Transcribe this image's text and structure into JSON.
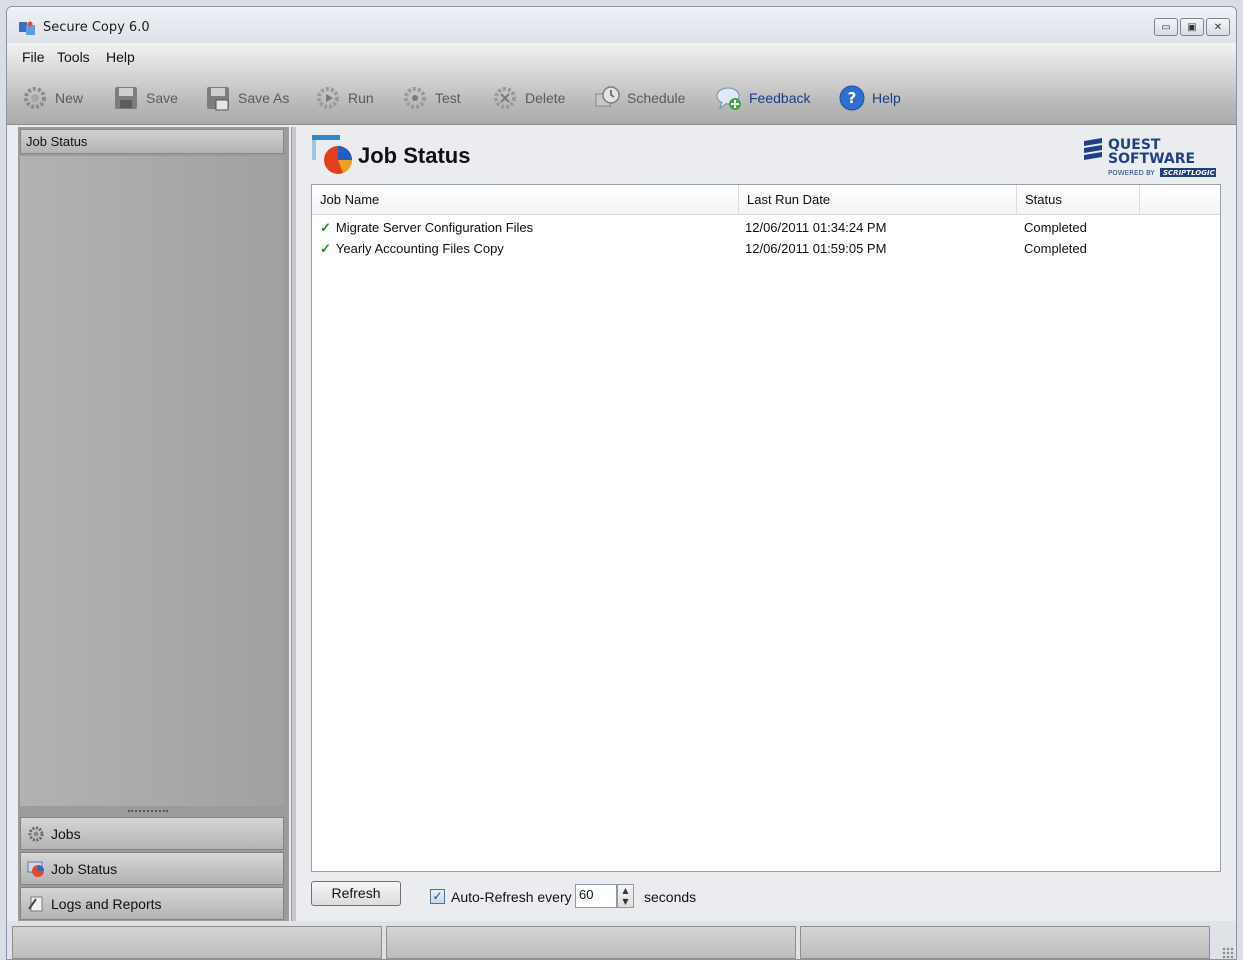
{
  "window": {
    "title": "Secure Copy 6.0"
  },
  "menu": [
    "File",
    "Tools",
    "Help"
  ],
  "toolbar": {
    "new": "New",
    "save": "Save",
    "save_as": "Save As",
    "run": "Run",
    "test": "Test",
    "delete": "Delete",
    "schedule": "Schedule",
    "feedback": "Feedback",
    "help": "Help"
  },
  "left_panel": {
    "header": "Job Status",
    "nav": {
      "jobs": "Jobs",
      "job_status": "Job Status",
      "logs": "Logs and Reports"
    }
  },
  "content": {
    "title": "Job Status",
    "brand": {
      "line1": "QUEST",
      "line2": "SOFTWARE",
      "powered": "POWERED BY",
      "partner": "SCRIPTLOGIC"
    },
    "columns": {
      "name": "Job Name",
      "date": "Last Run Date",
      "status": "Status"
    },
    "rows": [
      {
        "name": "Migrate Server Configuration Files",
        "date": "12/06/2011 01:34:24 PM",
        "status": "Completed"
      },
      {
        "name": "Yearly Accounting Files Copy",
        "date": "12/06/2011 01:59:05 PM",
        "status": "Completed"
      }
    ],
    "refresh_label": "Refresh",
    "auto_refresh": {
      "label": "Auto-Refresh every",
      "value": "60",
      "unit": "seconds",
      "checked": true
    }
  },
  "colors": {
    "accent_link": "#1a3c8a",
    "check_green": "#1f8f1f"
  }
}
